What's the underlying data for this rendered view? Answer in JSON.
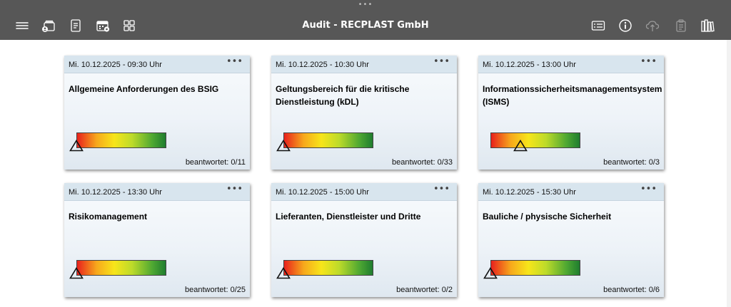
{
  "window": {
    "title": "Audit - RECPLAST GmbH",
    "grabber": "•••"
  },
  "toolbar": {
    "left_icons": [
      "menu-icon",
      "user-cards-icon",
      "document-icon",
      "calendar-settings-icon",
      "grid-icon"
    ],
    "right_icons": [
      "list-card-icon",
      "info-icon",
      "cloud-upload-icon",
      "clipboard-icon",
      "library-icon"
    ]
  },
  "colors": {
    "topbar": "#575757",
    "card_header": "#d8e5ee",
    "gauge_red": "#e8211d",
    "gauge_yellow": "#f7e51a",
    "gauge_green": "#1f7d2f"
  },
  "cards": [
    {
      "date": "Mi. 10.12.2025 - 09:30 Uhr",
      "menu": "•••",
      "title": "Allgemeine Anforderungen des BSIG",
      "answered": "beantwortet: 0/11",
      "gauge_level": 0
    },
    {
      "date": "Mi. 10.12.2025 - 10:30 Uhr",
      "menu": "•••",
      "title": "Geltungsbereich für die kritische Dienstleistung (kDL)",
      "answered": "beantwortet: 0/33",
      "gauge_level": 0
    },
    {
      "date": "Mi. 10.12.2025 - 13:00 Uhr",
      "menu": "•••",
      "title": "Informationssicherheitsmanagementsystem (ISMS)",
      "answered": "beantwortet: 0/3",
      "gauge_level": 0.33
    },
    {
      "date": "Mi. 10.12.2025 - 13:30 Uhr",
      "menu": "•••",
      "title": "Risikomanagement",
      "answered": "beantwortet: 0/25",
      "gauge_level": 0
    },
    {
      "date": "Mi. 10.12.2025 - 15:00 Uhr",
      "menu": "•••",
      "title": "Lieferanten, Dienstleister und Dritte",
      "answered": "beantwortet: 0/2",
      "gauge_level": 0
    },
    {
      "date": "Mi. 10.12.2025 - 15:30 Uhr",
      "menu": "•••",
      "title": "Bauliche / physische Sicherheit",
      "answered": "beantwortet: 0/6",
      "gauge_level": 0
    }
  ]
}
